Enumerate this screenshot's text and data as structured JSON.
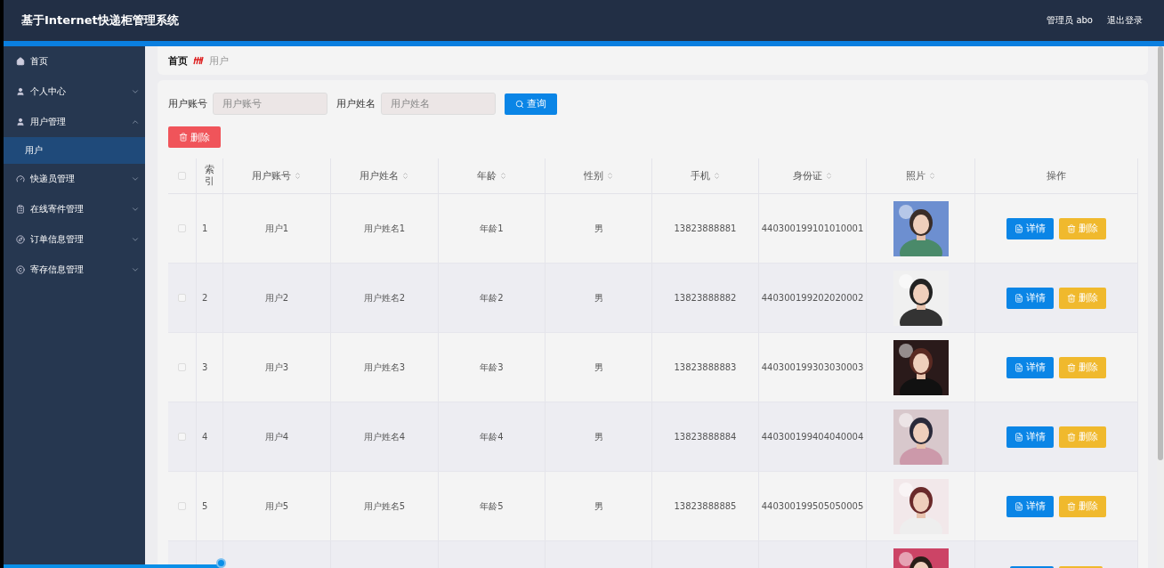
{
  "header": {
    "title": "基于Internet快递柜管理系统",
    "user": "管理员 abo",
    "logout": "退出登录"
  },
  "sidebar": {
    "items": [
      {
        "label": "首页",
        "kind": "link",
        "selected": false
      },
      {
        "label": "个人中心",
        "kind": "menu",
        "expanded": false,
        "selected": false
      },
      {
        "label": "用户管理",
        "kind": "menu",
        "expanded": true,
        "selected": false,
        "children": [
          {
            "label": "用户",
            "selected": true
          }
        ]
      },
      {
        "label": "快递员管理",
        "kind": "menu",
        "expanded": false,
        "selected": false
      },
      {
        "label": "在线寄件管理",
        "kind": "menu",
        "expanded": false,
        "selected": false
      },
      {
        "label": "订单信息管理",
        "kind": "menu",
        "expanded": false,
        "selected": false
      },
      {
        "label": "寄存信息管理",
        "kind": "menu",
        "expanded": false,
        "selected": false
      }
    ]
  },
  "breadcrumb": [
    "首页",
    "用户"
  ],
  "search": {
    "fields": [
      {
        "label": "用户账号",
        "placeholder": "用户账号"
      },
      {
        "label": "用户姓名",
        "placeholder": "用户姓名"
      }
    ],
    "button": "查询"
  },
  "delete_button": "删除",
  "table": {
    "select_all": {
      "checked": false
    },
    "columns": [
      {
        "label": "索引",
        "sortable": false
      },
      {
        "label": "用户账号",
        "sortable": true
      },
      {
        "label": "用户姓名",
        "sortable": true
      },
      {
        "label": "年龄",
        "sortable": true
      },
      {
        "label": "性别",
        "sortable": true
      },
      {
        "label": "手机",
        "sortable": true
      },
      {
        "label": "身份证",
        "sortable": true
      },
      {
        "label": "照片",
        "sortable": true
      },
      {
        "label": "操作",
        "sortable": false
      }
    ],
    "rows": [
      {
        "cells": [
          "1",
          "用户1",
          "用户姓名1",
          "年龄1",
          "男",
          "13823888881",
          "440300199101010001"
        ],
        "checked": false,
        "actions": [
          "详情",
          "删除"
        ]
      },
      {
        "cells": [
          "2",
          "用户2",
          "用户姓名2",
          "年龄2",
          "男",
          "13823888882",
          "440300199202020002"
        ],
        "checked": false,
        "actions": [
          "详情",
          "删除"
        ]
      },
      {
        "cells": [
          "3",
          "用户3",
          "用户姓名3",
          "年龄3",
          "男",
          "13823888883",
          "440300199303030003"
        ],
        "checked": false,
        "actions": [
          "详情",
          "删除"
        ]
      },
      {
        "cells": [
          "4",
          "用户4",
          "用户姓名4",
          "年龄4",
          "男",
          "13823888884",
          "440300199404040004"
        ],
        "checked": false,
        "actions": [
          "详情",
          "删除"
        ]
      },
      {
        "cells": [
          "5",
          "用户5",
          "用户姓名5",
          "年龄5",
          "男",
          "13823888885",
          "440300199505050005"
        ],
        "checked": false,
        "actions": [
          "详情",
          "删除"
        ]
      }
    ]
  },
  "playback": {
    "level": 0.19
  }
}
